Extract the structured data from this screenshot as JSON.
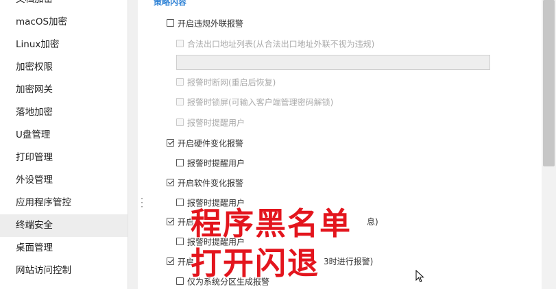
{
  "sidebar": {
    "items": [
      {
        "label": "文档加密"
      },
      {
        "label": "macOS加密"
      },
      {
        "label": "Linux加密"
      },
      {
        "label": "加密权限"
      },
      {
        "label": "加密网关"
      },
      {
        "label": "落地加密"
      },
      {
        "label": "U盘管理"
      },
      {
        "label": "打印管理"
      },
      {
        "label": "外设管理"
      },
      {
        "label": "应用程序管控"
      },
      {
        "label": "终端安全"
      },
      {
        "label": "桌面管理"
      },
      {
        "label": "网站访问控制"
      }
    ],
    "active_index": 10
  },
  "content": {
    "section_title": "策略内容",
    "options": [
      {
        "label": "开启违规外联报警",
        "checked": false,
        "disabled": false
      },
      {
        "label": "合法出口地址列表(从合法出口地址外联不视为违规)",
        "checked": false,
        "disabled": true
      },
      {
        "label": "报警时断网(重启后恢复)",
        "checked": false,
        "disabled": true
      },
      {
        "label": "报警时锁屏(可输入客户端管理密码解锁)",
        "checked": false,
        "disabled": true
      },
      {
        "label": "报警时提醒用户",
        "checked": false,
        "disabled": true
      },
      {
        "label": "开启硬件变化报警",
        "checked": true,
        "disabled": false
      },
      {
        "label": "报警时提醒用户",
        "checked": false,
        "disabled": false
      },
      {
        "label": "开启软件变化报警",
        "checked": true,
        "disabled": false
      },
      {
        "label": "报警时提醒用户",
        "checked": false,
        "disabled": false
      },
      {
        "label": "开启",
        "suffix": "息)",
        "checked": true,
        "disabled": false
      },
      {
        "label": "报警时提醒用户",
        "checked": false,
        "disabled": false
      },
      {
        "label": "开启",
        "suffix": "3时进行报警)",
        "checked": true,
        "disabled": false
      },
      {
        "label": "仅为系统分区生成报警",
        "checked": false,
        "disabled": false
      }
    ],
    "exit_address_input": {
      "value": ""
    }
  },
  "overlay": {
    "line1": "程序黑名单",
    "line2": "打开闪退",
    "color": "#e3151d"
  },
  "icons": {
    "drag_handle": "drag-handle-icon",
    "cursor": "mouse-cursor-icon"
  }
}
